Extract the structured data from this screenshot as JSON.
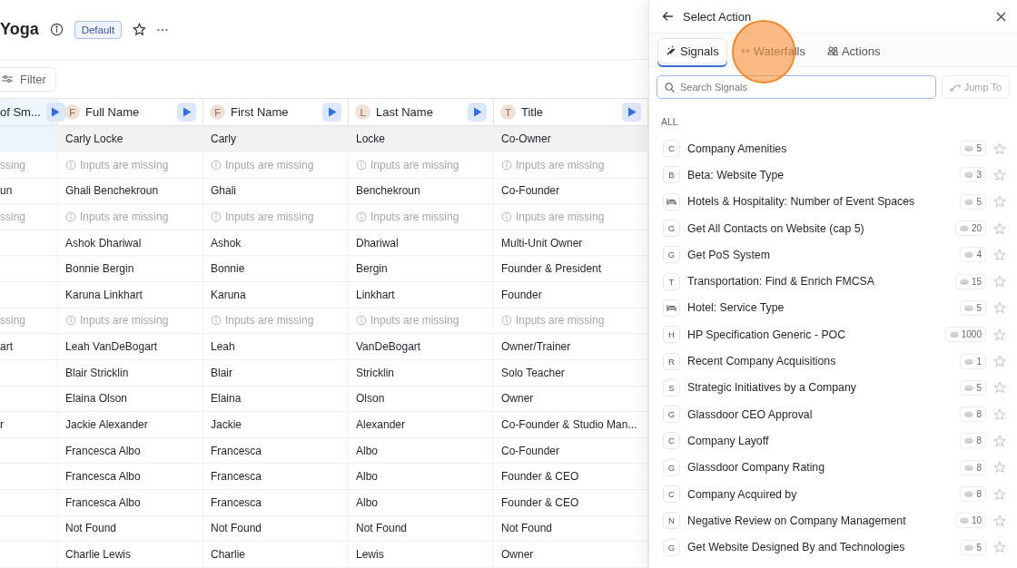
{
  "page": {
    "title": "Yoga",
    "badge": "Default",
    "filter": "Filter"
  },
  "table": {
    "columns": [
      {
        "label": "of Sm..."
      },
      {
        "label": "Full Name",
        "letter": "F"
      },
      {
        "label": "First Name",
        "letter": "F"
      },
      {
        "label": "Last Name",
        "letter": "L"
      },
      {
        "label": "Title",
        "letter": "T"
      }
    ],
    "rows": [
      {
        "selected": true,
        "cells": [
          {
            "kind": "value",
            "text": ""
          },
          {
            "kind": "value",
            "text": "Carly Locke"
          },
          {
            "kind": "value",
            "text": "Carly"
          },
          {
            "kind": "value",
            "text": "Locke"
          },
          {
            "kind": "value",
            "text": "Co-Owner"
          }
        ]
      },
      {
        "selected": false,
        "cells": [
          {
            "kind": "cut",
            "text": "ssing"
          },
          {
            "kind": "missing",
            "text": "Inputs are missing"
          },
          {
            "kind": "missing",
            "text": "Inputs are missing"
          },
          {
            "kind": "missing",
            "text": "Inputs are missing"
          },
          {
            "kind": "missing",
            "text": "Inputs are missing"
          }
        ]
      },
      {
        "selected": false,
        "cells": [
          {
            "kind": "value",
            "text": "un"
          },
          {
            "kind": "value",
            "text": "Ghali Benchekroun"
          },
          {
            "kind": "value",
            "text": "Ghali"
          },
          {
            "kind": "value",
            "text": "Benchekroun"
          },
          {
            "kind": "value",
            "text": "Co-Founder"
          }
        ]
      },
      {
        "selected": false,
        "cells": [
          {
            "kind": "cut",
            "text": "ssing"
          },
          {
            "kind": "missing",
            "text": "Inputs are missing"
          },
          {
            "kind": "missing",
            "text": "Inputs are missing"
          },
          {
            "kind": "missing",
            "text": "Inputs are missing"
          },
          {
            "kind": "missing",
            "text": "Inputs are missing"
          }
        ]
      },
      {
        "selected": false,
        "cells": [
          {
            "kind": "value",
            "text": ""
          },
          {
            "kind": "value",
            "text": "Ashok Dhariwal"
          },
          {
            "kind": "value",
            "text": "Ashok"
          },
          {
            "kind": "value",
            "text": "Dhariwal"
          },
          {
            "kind": "value",
            "text": "Multi-Unit Owner"
          }
        ]
      },
      {
        "selected": false,
        "cells": [
          {
            "kind": "value",
            "text": ""
          },
          {
            "kind": "value",
            "text": "Bonnie Bergin"
          },
          {
            "kind": "value",
            "text": "Bonnie"
          },
          {
            "kind": "value",
            "text": "Bergin"
          },
          {
            "kind": "value",
            "text": "Founder & President"
          }
        ]
      },
      {
        "selected": false,
        "cells": [
          {
            "kind": "value",
            "text": ""
          },
          {
            "kind": "value",
            "text": "Karuna Linkhart"
          },
          {
            "kind": "value",
            "text": "Karuna"
          },
          {
            "kind": "value",
            "text": "Linkhart"
          },
          {
            "kind": "value",
            "text": "Founder"
          }
        ]
      },
      {
        "selected": false,
        "cells": [
          {
            "kind": "cut",
            "text": "ssing"
          },
          {
            "kind": "missing",
            "text": "Inputs are missing"
          },
          {
            "kind": "missing",
            "text": "Inputs are missing"
          },
          {
            "kind": "missing",
            "text": "Inputs are missing"
          },
          {
            "kind": "missing",
            "text": "Inputs are missing"
          }
        ]
      },
      {
        "selected": false,
        "cells": [
          {
            "kind": "value",
            "text": "art"
          },
          {
            "kind": "value",
            "text": "Leah VanDeBogart"
          },
          {
            "kind": "value",
            "text": "Leah"
          },
          {
            "kind": "value",
            "text": "VanDeBogart"
          },
          {
            "kind": "value",
            "text": "Owner/Trainer"
          }
        ]
      },
      {
        "selected": false,
        "cells": [
          {
            "kind": "value",
            "text": ""
          },
          {
            "kind": "value",
            "text": "Blair Stricklin"
          },
          {
            "kind": "value",
            "text": "Blair"
          },
          {
            "kind": "value",
            "text": "Stricklin"
          },
          {
            "kind": "value",
            "text": "Solo Teacher"
          }
        ]
      },
      {
        "selected": false,
        "cells": [
          {
            "kind": "value",
            "text": ""
          },
          {
            "kind": "value",
            "text": "Elaina Olson"
          },
          {
            "kind": "value",
            "text": "Elaina"
          },
          {
            "kind": "value",
            "text": "Olson"
          },
          {
            "kind": "value",
            "text": "Owner"
          }
        ]
      },
      {
        "selected": false,
        "cells": [
          {
            "kind": "value",
            "text": "r"
          },
          {
            "kind": "value",
            "text": "Jackie Alexander"
          },
          {
            "kind": "value",
            "text": "Jackie"
          },
          {
            "kind": "value",
            "text": "Alexander"
          },
          {
            "kind": "value",
            "text": "Co-Founder & Studio Man..."
          }
        ]
      },
      {
        "selected": false,
        "cells": [
          {
            "kind": "value",
            "text": ""
          },
          {
            "kind": "value",
            "text": "Francesca Albo"
          },
          {
            "kind": "value",
            "text": "Francesca"
          },
          {
            "kind": "value",
            "text": "Albo"
          },
          {
            "kind": "value",
            "text": "Co-Founder"
          }
        ]
      },
      {
        "selected": false,
        "cells": [
          {
            "kind": "value",
            "text": ""
          },
          {
            "kind": "value",
            "text": "Francesca Albo"
          },
          {
            "kind": "value",
            "text": "Francesca"
          },
          {
            "kind": "value",
            "text": "Albo"
          },
          {
            "kind": "value",
            "text": "Founder & CEO"
          }
        ]
      },
      {
        "selected": false,
        "cells": [
          {
            "kind": "value",
            "text": ""
          },
          {
            "kind": "value",
            "text": "Francesca Albo"
          },
          {
            "kind": "value",
            "text": "Francesca"
          },
          {
            "kind": "value",
            "text": "Albo"
          },
          {
            "kind": "value",
            "text": "Founder & CEO"
          }
        ]
      },
      {
        "selected": false,
        "cells": [
          {
            "kind": "value",
            "text": ""
          },
          {
            "kind": "value",
            "text": "Not Found"
          },
          {
            "kind": "value",
            "text": "Not Found"
          },
          {
            "kind": "value",
            "text": "Not Found"
          },
          {
            "kind": "value",
            "text": "Not Found"
          }
        ]
      },
      {
        "selected": false,
        "cells": [
          {
            "kind": "value",
            "text": ""
          },
          {
            "kind": "value",
            "text": "Charlie Lewis"
          },
          {
            "kind": "value",
            "text": "Charlie"
          },
          {
            "kind": "value",
            "text": "Lewis"
          },
          {
            "kind": "value",
            "text": "Owner"
          }
        ]
      }
    ]
  },
  "panel": {
    "title": "Select Action",
    "tabs": [
      {
        "label": "Signals",
        "selected": true
      },
      {
        "label": "Waterfalls",
        "selected": false
      },
      {
        "label": "Actions",
        "selected": false
      }
    ],
    "search": {
      "placeholder": "Search Signals"
    },
    "jump_button": {
      "label": "Jump To",
      "disabled": true
    },
    "section": "ALL",
    "signals": [
      {
        "kind": "letter",
        "letter": "C",
        "name": "Company Amenities",
        "credits": "5",
        "starred": false
      },
      {
        "kind": "letter",
        "letter": "B",
        "name": "Beta: Website Type",
        "credits": "3",
        "starred": false
      },
      {
        "kind": "hotel",
        "name": "Hotels & Hospitality: Number of Event Spaces",
        "credits": "5",
        "starred": false
      },
      {
        "kind": "letter",
        "letter": "G",
        "name": "Get All Contacts on Website (cap 5)",
        "credits": "20",
        "starred": false
      },
      {
        "kind": "letter",
        "letter": "G",
        "name": "Get PoS System",
        "credits": "4",
        "starred": false
      },
      {
        "kind": "letter",
        "letter": "T",
        "name": "Transportation: Find & Enrich FMCSA",
        "credits": "15",
        "starred": false
      },
      {
        "kind": "hotel",
        "name": "Hotel: Service Type",
        "credits": "5",
        "starred": false
      },
      {
        "kind": "letter",
        "letter": "H",
        "name": "HP Specification Generic - POC",
        "credits": "1000",
        "starred": false
      },
      {
        "kind": "letter",
        "letter": "R",
        "name": "Recent Company Acquisitions",
        "credits": "1",
        "starred": false
      },
      {
        "kind": "letter",
        "letter": "S",
        "name": "Strategic Initiatives by a Company",
        "credits": "5",
        "starred": false
      },
      {
        "kind": "letter",
        "letter": "G",
        "name": "Glassdoor CEO Approval",
        "credits": "8",
        "starred": false
      },
      {
        "kind": "letter",
        "letter": "C",
        "name": "Company Layoff",
        "credits": "8",
        "starred": false
      },
      {
        "kind": "letter",
        "letter": "G",
        "name": "Glassdoor Company Rating",
        "credits": "8",
        "starred": false
      },
      {
        "kind": "letter",
        "letter": "C",
        "name": "Company Acquired by",
        "credits": "8",
        "starred": false
      },
      {
        "kind": "letter",
        "letter": "N",
        "name": "Negative Review on Company Management",
        "credits": "10",
        "starred": false
      },
      {
        "kind": "letter",
        "letter": "G",
        "name": "Get Website Designed By and Technologies",
        "credits": "5",
        "starred": false
      }
    ]
  }
}
